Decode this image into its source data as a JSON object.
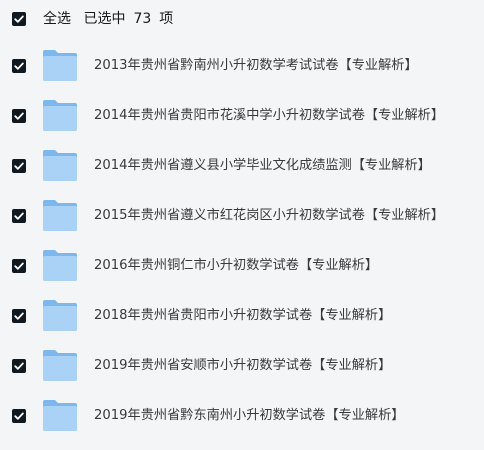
{
  "header": {
    "select_all_label": "全选",
    "selected_prefix": "已选中",
    "selected_count": "73",
    "selected_suffix": "项"
  },
  "files": [
    {
      "name": "2013年贵州省黔南州小升初数学考试试卷【专业解析】",
      "checked": true,
      "icon": "folder-icon"
    },
    {
      "name": "2014年贵州省贵阳市花溪中学小升初数学试卷【专业解析】",
      "checked": true,
      "icon": "folder-icon"
    },
    {
      "name": "2014年贵州省遵义县小学毕业文化成绩监测【专业解析】",
      "checked": true,
      "icon": "folder-icon"
    },
    {
      "name": "2015年贵州省遵义市红花岗区小升初数学试卷【专业解析】",
      "checked": true,
      "icon": "folder-icon"
    },
    {
      "name": "2016年贵州铜仁市小升初数学试卷【专业解析】",
      "checked": true,
      "icon": "folder-icon"
    },
    {
      "name": "2018年贵州省贵阳市小升初数学试卷【专业解析】",
      "checked": true,
      "icon": "folder-icon"
    },
    {
      "name": "2019年贵州省安顺市小升初数学试卷【专业解析】",
      "checked": true,
      "icon": "folder-icon"
    },
    {
      "name": "2019年贵州省黔东南州小升初数学试卷【专业解析】",
      "checked": true,
      "icon": "folder-icon"
    }
  ],
  "colors": {
    "background": "#f4f5f7",
    "checkbox": "#101820",
    "folder_light": "#a9d2f6",
    "folder_dark": "#7db7ec"
  }
}
